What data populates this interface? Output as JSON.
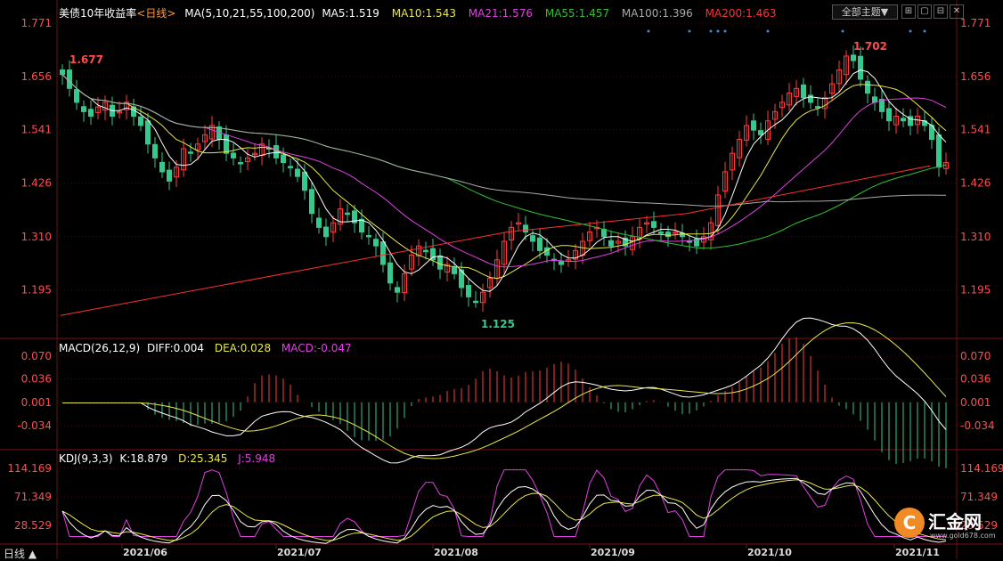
{
  "header": {
    "title": "美债10年收益率",
    "period_link": "<日线>",
    "ma_params": "MA(5,10,21,55,100,200)",
    "ma_values": [
      {
        "label": "MA5:1.519",
        "color": "#ffffff"
      },
      {
        "label": "MA10:1.543",
        "color": "#e8e84a"
      },
      {
        "label": "MA21:1.576",
        "color": "#e040e0"
      },
      {
        "label": "MA55:1.457",
        "color": "#30c030"
      },
      {
        "label": "MA100:1.396",
        "color": "#aaaaaa"
      },
      {
        "label": "MA200:1.463",
        "color": "#ff3030"
      }
    ],
    "theme_button": "全部主题▼",
    "window_buttons": [
      "⊞",
      "▢",
      "⊟",
      "✕"
    ]
  },
  "price_panel": {
    "y_ticks": [
      "1.771",
      "1.656",
      "1.541",
      "1.426",
      "1.310",
      "1.195"
    ],
    "high_label": "1.702",
    "low_label": "1.125",
    "start_label": "1.677"
  },
  "macd_panel": {
    "title": "MACD(26,12,9)",
    "diff": "DIFF:0.004",
    "dea": "DEA:0.028",
    "macd": "MACD:-0.047",
    "y_ticks": [
      "0.070",
      "0.036",
      "0.001",
      "-0.034"
    ]
  },
  "kdj_panel": {
    "title": "KDJ(9,3,3)",
    "k": "K:18.879",
    "d": "D:25.345",
    "j": "J:5.948",
    "y_ticks": [
      "114.169",
      "71.349",
      "28.529"
    ]
  },
  "x_ticks": [
    "2021/06",
    "2021/07",
    "2021/08",
    "2021/09",
    "2021/10",
    "2021/11"
  ],
  "period_label": "日线 ▲",
  "logo": {
    "name": "汇金网",
    "url": "www.gold678.com"
  },
  "colors": {
    "up": "#ff3b3b",
    "down": "#36c98e",
    "grid": "#3a0e0e",
    "axis_text": "#ff4d4d"
  },
  "chart_data": {
    "type": "candlestick",
    "title": "美债10年收益率",
    "x_labels": [
      "2021/06",
      "2021/07",
      "2021/08",
      "2021/09",
      "2021/10",
      "2021/11"
    ],
    "close_series": [
      1.66,
      1.63,
      1.6,
      1.58,
      1.57,
      1.59,
      1.6,
      1.57,
      1.58,
      1.6,
      1.57,
      1.55,
      1.51,
      1.48,
      1.45,
      1.43,
      1.46,
      1.5,
      1.49,
      1.51,
      1.53,
      1.55,
      1.52,
      1.49,
      1.48,
      1.47,
      1.48,
      1.49,
      1.51,
      1.5,
      1.48,
      1.47,
      1.46,
      1.44,
      1.41,
      1.36,
      1.33,
      1.31,
      1.34,
      1.37,
      1.36,
      1.34,
      1.32,
      1.31,
      1.29,
      1.25,
      1.21,
      1.19,
      1.23,
      1.27,
      1.29,
      1.28,
      1.26,
      1.24,
      1.25,
      1.23,
      1.2,
      1.18,
      1.17,
      1.19,
      1.22,
      1.26,
      1.3,
      1.33,
      1.34,
      1.32,
      1.3,
      1.28,
      1.27,
      1.26,
      1.25,
      1.26,
      1.28,
      1.3,
      1.32,
      1.33,
      1.31,
      1.29,
      1.3,
      1.29,
      1.31,
      1.33,
      1.34,
      1.33,
      1.32,
      1.31,
      1.32,
      1.31,
      1.3,
      1.29,
      1.31,
      1.34,
      1.4,
      1.45,
      1.49,
      1.52,
      1.55,
      1.54,
      1.53,
      1.56,
      1.58,
      1.6,
      1.62,
      1.63,
      1.61,
      1.6,
      1.59,
      1.61,
      1.64,
      1.67,
      1.7,
      1.69,
      1.65,
      1.62,
      1.6,
      1.58,
      1.56,
      1.57,
      1.56,
      1.55,
      1.57,
      1.55,
      1.52,
      1.46,
      1.47
    ],
    "ma_series": [
      {
        "name": "MA5",
        "last": 1.519
      },
      {
        "name": "MA10",
        "last": 1.543
      },
      {
        "name": "MA21",
        "last": 1.576
      },
      {
        "name": "MA55",
        "last": 1.457
      },
      {
        "name": "MA100",
        "last": 1.396
      },
      {
        "name": "MA200",
        "last": 1.463
      }
    ],
    "high": 1.702,
    "low": 1.125,
    "first_high": 1.677,
    "y_range": [
      1.125,
      1.771
    ],
    "macd": {
      "diff": 0.004,
      "dea": 0.028,
      "macd": -0.047,
      "range": [
        -0.034,
        0.07
      ]
    },
    "kdj": {
      "k": 18.879,
      "d": 25.345,
      "j": 5.948,
      "range": [
        28.529,
        114.169
      ]
    }
  }
}
